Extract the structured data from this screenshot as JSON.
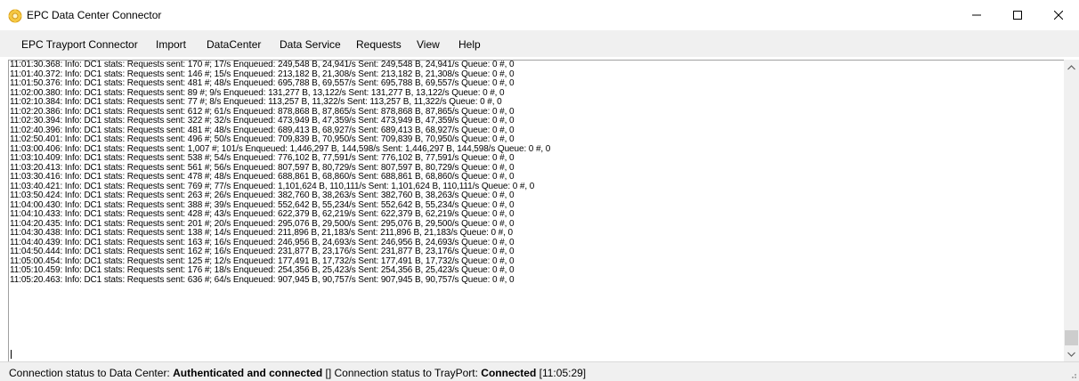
{
  "window": {
    "title": "EPC Data Center Connector",
    "icon": "app-gear-icon"
  },
  "menu": {
    "items": [
      "EPC Trayport Connector",
      "Import",
      "DataCenter",
      "Data Service",
      "Requests",
      "View",
      "Help"
    ]
  },
  "log": {
    "lines": [
      "11:01:30.368: Info: DC1 stats: Requests sent: 170 #; 17/s Enqueued: 249,548 B, 24,941/s Sent: 249,548 B, 24,941/s Queue: 0 #, 0",
      "11:01:40.372: Info: DC1 stats: Requests sent: 146 #; 15/s Enqueued: 213,182 B, 21,308/s Sent: 213,182 B, 21,308/s Queue: 0 #, 0",
      "11:01:50.376: Info: DC1 stats: Requests sent: 481 #; 48/s Enqueued: 695,788 B, 69,557/s Sent: 695,788 B, 69,557/s Queue: 0 #, 0",
      "11:02:00.380: Info: DC1 stats: Requests sent: 89 #; 9/s Enqueued: 131,277 B, 13,122/s Sent: 131,277 B, 13,122/s Queue: 0 #, 0",
      "11:02:10.384: Info: DC1 stats: Requests sent: 77 #; 8/s Enqueued: 113,257 B, 11,322/s Sent: 113,257 B, 11,322/s Queue: 0 #, 0",
      "11:02:20.386: Info: DC1 stats: Requests sent: 612 #; 61/s Enqueued: 878,868 B, 87,865/s Sent: 878,868 B, 87,865/s Queue: 0 #, 0",
      "11:02:30.394: Info: DC1 stats: Requests sent: 322 #; 32/s Enqueued: 473,949 B, 47,359/s Sent: 473,949 B, 47,359/s Queue: 0 #, 0",
      "11:02:40.396: Info: DC1 stats: Requests sent: 481 #; 48/s Enqueued: 689,413 B, 68,927/s Sent: 689,413 B, 68,927/s Queue: 0 #, 0",
      "11:02:50.401: Info: DC1 stats: Requests sent: 496 #; 50/s Enqueued: 709,839 B, 70,950/s Sent: 709,839 B, 70,950/s Queue: 0 #, 0",
      "11:03:00.406: Info: DC1 stats: Requests sent: 1,007 #; 101/s Enqueued: 1,446,297 B, 144,598/s Sent: 1,446,297 B, 144,598/s Queue: 0 #, 0",
      "11:03:10.409: Info: DC1 stats: Requests sent: 538 #; 54/s Enqueued: 776,102 B, 77,591/s Sent: 776,102 B, 77,591/s Queue: 0 #, 0",
      "11:03:20.413: Info: DC1 stats: Requests sent: 561 #; 56/s Enqueued: 807,597 B, 80,729/s Sent: 807,597 B, 80,729/s Queue: 0 #, 0",
      "11:03:30.416: Info: DC1 stats: Requests sent: 478 #; 48/s Enqueued: 688,861 B, 68,860/s Sent: 688,861 B, 68,860/s Queue: 0 #, 0",
      "11:03:40.421: Info: DC1 stats: Requests sent: 769 #; 77/s Enqueued: 1,101,624 B, 110,111/s Sent: 1,101,624 B, 110,111/s Queue: 0 #, 0",
      "11:03:50.424: Info: DC1 stats: Requests sent: 263 #; 26/s Enqueued: 382,760 B, 38,263/s Sent: 382,760 B, 38,263/s Queue: 0 #, 0",
      "11:04:00.430: Info: DC1 stats: Requests sent: 388 #; 39/s Enqueued: 552,642 B, 55,234/s Sent: 552,642 B, 55,234/s Queue: 0 #, 0",
      "11:04:10.433: Info: DC1 stats: Requests sent: 428 #; 43/s Enqueued: 622,379 B, 62,219/s Sent: 622,379 B, 62,219/s Queue: 0 #, 0",
      "11:04:20.435: Info: DC1 stats: Requests sent: 201 #; 20/s Enqueued: 295,076 B, 29,500/s Sent: 295,076 B, 29,500/s Queue: 0 #, 0",
      "11:04:30.438: Info: DC1 stats: Requests sent: 138 #; 14/s Enqueued: 211,896 B, 21,183/s Sent: 211,896 B, 21,183/s Queue: 0 #, 0",
      "11:04:40.439: Info: DC1 stats: Requests sent: 163 #; 16/s Enqueued: 246,956 B, 24,693/s Sent: 246,956 B, 24,693/s Queue: 0 #, 0",
      "11:04:50.444: Info: DC1 stats: Requests sent: 162 #; 16/s Enqueued: 231,877 B, 23,176/s Sent: 231,877 B, 23,176/s Queue: 0 #, 0",
      "11:05:00.454: Info: DC1 stats: Requests sent: 125 #; 12/s Enqueued: 177,491 B, 17,732/s Sent: 177,491 B, 17,732/s Queue: 0 #, 0",
      "11:05:10.459: Info: DC1 stats: Requests sent: 176 #; 18/s Enqueued: 254,356 B, 25,423/s Sent: 254,356 B, 25,423/s Queue: 0 #, 0",
      "11:05:20.463: Info: DC1 stats: Requests sent: 636 #; 64/s Enqueued: 907,945 B, 90,757/s Sent: 907,945 B, 90,757/s Queue: 0 #, 0"
    ]
  },
  "status": {
    "dc_label": "Connection status to Data Center:",
    "dc_value": "Authenticated and connected",
    "dc_extra": "[]",
    "tp_label": "Connection status to TrayPort:",
    "tp_value": "Connected",
    "tp_time": "[11:05:29]"
  },
  "colors": {
    "menu_bg": "#f0f0f0",
    "icon_yellow": "#f5c842"
  }
}
